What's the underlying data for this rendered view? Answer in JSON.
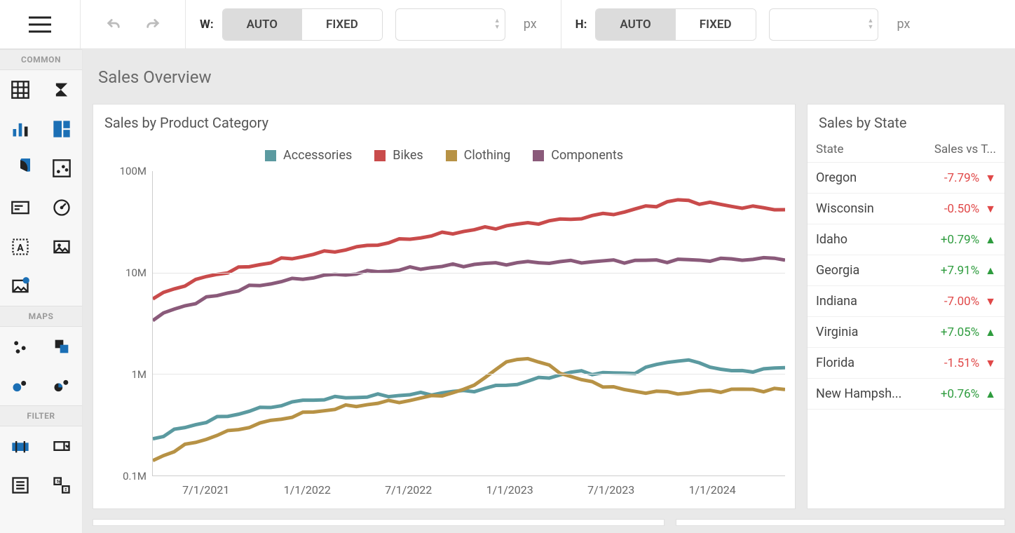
{
  "toolbar": {
    "width_label": "W:",
    "height_label": "H:",
    "auto_label": "AUTO",
    "fixed_label": "FIXED",
    "unit": "px"
  },
  "sidebar": {
    "sections": {
      "common": "COMMON",
      "maps": "MAPS",
      "filter": "FILTER"
    }
  },
  "dashboard": {
    "title": "Sales Overview",
    "chart_title": "Sales by Product Category",
    "table_title": "Sales by State",
    "table_headers": {
      "state": "State",
      "value": "Sales vs T..."
    }
  },
  "legend": {
    "accessories": "Accessories",
    "bikes": "Bikes",
    "clothing": "Clothing",
    "components": "Components"
  },
  "colors": {
    "accessories": "#5b9aa0",
    "bikes": "#c94b4b",
    "clothing": "#b79245",
    "components": "#8a5a7a"
  },
  "y_ticks": [
    "100M",
    "10M",
    "1M",
    "0.1M"
  ],
  "x_ticks": [
    "7/1/2021",
    "1/1/2022",
    "7/1/2022",
    "1/1/2023",
    "7/1/2023",
    "1/1/2024"
  ],
  "state_rows": [
    {
      "name": "Oregon",
      "value": "-7.79%",
      "dir": "down"
    },
    {
      "name": "Wisconsin",
      "value": "-0.50%",
      "dir": "down"
    },
    {
      "name": "Idaho",
      "value": "+0.79%",
      "dir": "up"
    },
    {
      "name": "Georgia",
      "value": "+7.91%",
      "dir": "up"
    },
    {
      "name": "Indiana",
      "value": "-7.00%",
      "dir": "down"
    },
    {
      "name": "Virginia",
      "value": "+7.05%",
      "dir": "up"
    },
    {
      "name": "Florida",
      "value": "-1.51%",
      "dir": "down"
    },
    {
      "name": "New Hampsh...",
      "value": "+0.76%",
      "dir": "up"
    }
  ],
  "chart_data": {
    "type": "line",
    "y_scale": "log",
    "ylim": [
      100000,
      100000000
    ],
    "x": [
      "4/2021",
      "7/2021",
      "10/2021",
      "1/2022",
      "4/2022",
      "7/2022",
      "10/2022",
      "1/2023",
      "4/2023",
      "7/2023",
      "10/2023",
      "1/2024",
      "4/2024"
    ],
    "series": [
      {
        "name": "Bikes",
        "color": "#c94b4b",
        "values": [
          5500000,
          9000000,
          12000000,
          15000000,
          18000000,
          22000000,
          26000000,
          30000000,
          34000000,
          40000000,
          52000000,
          45000000,
          42000000
        ]
      },
      {
        "name": "Components",
        "color": "#8a5a7a",
        "values": [
          3500000,
          5500000,
          7500000,
          9000000,
          10000000,
          11000000,
          12000000,
          12500000,
          12800000,
          13000000,
          13200000,
          13500000,
          13800000
        ]
      },
      {
        "name": "Accessories",
        "color": "#5b9aa0",
        "values": [
          230000,
          340000,
          450000,
          560000,
          600000,
          630000,
          680000,
          820000,
          1050000,
          1000000,
          1400000,
          1050000,
          1150000
        ]
      },
      {
        "name": "Clothing",
        "color": "#b79245",
        "values": [
          140000,
          230000,
          320000,
          420000,
          500000,
          560000,
          700000,
          1500000,
          900000,
          680000,
          650000,
          700000,
          700000
        ]
      }
    ],
    "x_tick_labels": [
      "7/1/2021",
      "1/1/2022",
      "7/1/2022",
      "1/1/2023",
      "7/1/2023",
      "1/1/2024"
    ]
  }
}
